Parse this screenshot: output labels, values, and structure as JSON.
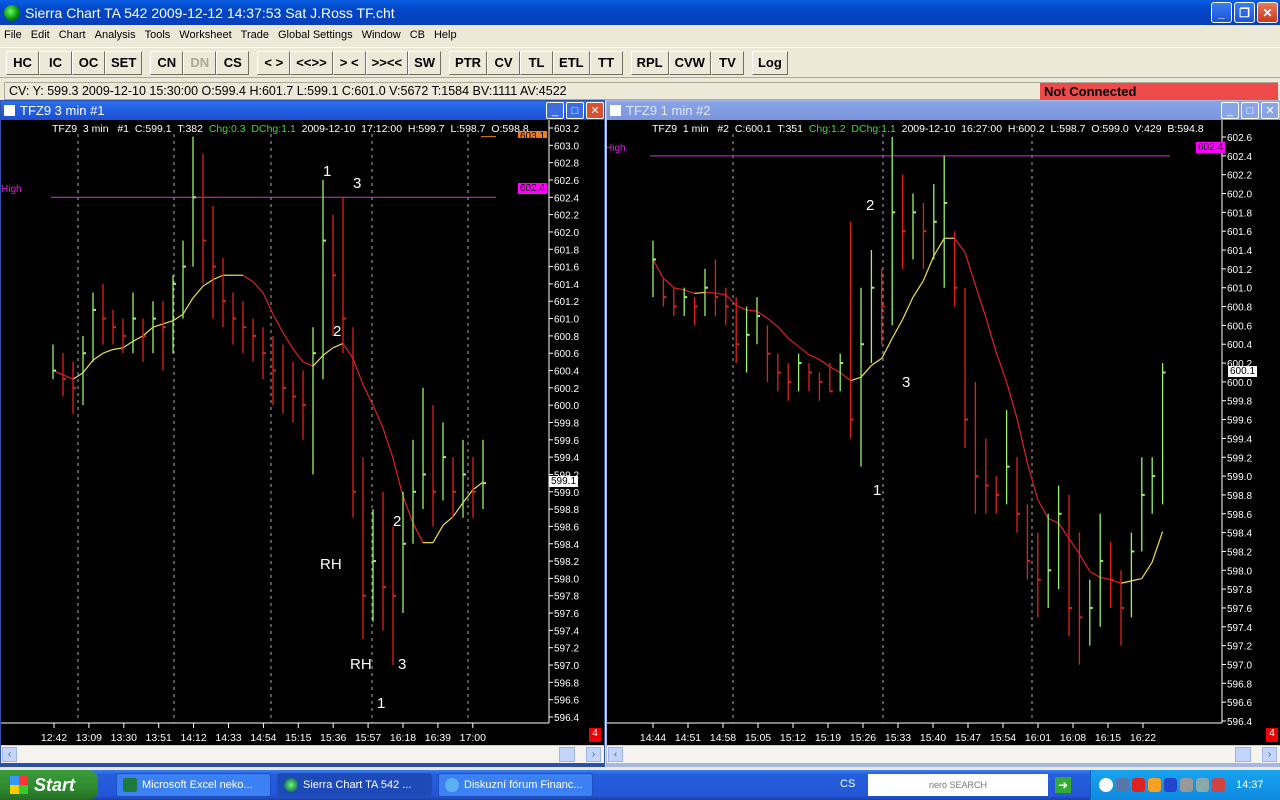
{
  "window": {
    "title": "Sierra Chart TA 542  2009-12-12  14:37:53  Sat   J.Ross TF.cht"
  },
  "menu": [
    "File",
    "Edit",
    "Chart",
    "Analysis",
    "Tools",
    "Worksheet",
    "Trade",
    "Global Settings",
    "Window",
    "CB",
    "Help"
  ],
  "toolbar": [
    "HC",
    "IC",
    "OC",
    "SET",
    "CN",
    "DN",
    "CS",
    "< >",
    "<<>>",
    "> <",
    ">><<",
    "SW",
    "PTR",
    "CV",
    "TL",
    "ETL",
    "TT",
    "RPL",
    "CVW",
    "TV",
    "Log"
  ],
  "status": {
    "cursor_values": "CV: Y: 599.3  2009-12-10  15:30:00  O:599.4  H:601.7  L:599.1  C:601.0  V:5672  T:1584  BV:1111  AV:4522",
    "connection": "Not Connected",
    "connection_color": "#ef4a4a"
  },
  "charts": [
    {
      "title": "TFZ9  3 min   #1",
      "header_a": "TFZ9  3 min   #1  C:599.1  T:382  ",
      "header_chg": "Chg:0.3  DChg:1.1",
      "header_b": "  2009-12-10  17:12:00  H:599.7  L:598.7  O:598.8",
      "high_label": "High",
      "high_tag": "602.4",
      "top_tag": "603.1",
      "last_tag": "599.1",
      "page_num": "4",
      "annotations": [
        "1",
        "3",
        "2",
        "2",
        "RH",
        "RH",
        "3",
        "1"
      ]
    },
    {
      "title": "TFZ9  1 min   #2",
      "header_a": "TFZ9  1 min   #2  C:600.1  T:351  ",
      "header_chg": "Chg:1.2  DChg:1.1",
      "header_b": "  2009-12-10  16:27:00  H:600.2  L:598.7  O:599.0  V:429  B:594.8",
      "high_label": "High",
      "high_tag": "602.4",
      "last_tag": "600.1",
      "page_num": "4",
      "annotations": [
        "2",
        "3",
        "1"
      ]
    }
  ],
  "chart_data": [
    {
      "type": "ohlc",
      "title": "TFZ9 3 min #1",
      "ylim": [
        596.4,
        603.2
      ],
      "high_line": 602.4,
      "top_line": 603.1,
      "up_color": "#9cf06a",
      "down_color": "#e02020",
      "y_ticks": [
        "603.2",
        "603.0",
        "602.8",
        "602.6",
        "602.4",
        "602.2",
        "602.0",
        "601.8",
        "601.6",
        "601.4",
        "601.2",
        "601.0",
        "600.8",
        "600.6",
        "600.4",
        "600.2",
        "600.0",
        "599.8",
        "599.6",
        "599.4",
        "599.2",
        "599.0",
        "598.8",
        "598.6",
        "598.4",
        "598.2",
        "598.0",
        "597.8",
        "597.6",
        "597.4",
        "597.2",
        "597.0",
        "596.8",
        "596.6",
        "596.4"
      ],
      "x_ticks": [
        "12:42",
        "13:09",
        "13:30",
        "13:51",
        "14:12",
        "14:33",
        "14:54",
        "15:15",
        "15:36",
        "15:57",
        "16:18",
        "16:39",
        "17:00"
      ],
      "bars_hlc": [
        [
          600.7,
          600.3,
          600.4
        ],
        [
          600.6,
          600.1,
          600.3
        ],
        [
          600.5,
          599.9,
          600.2
        ],
        [
          600.8,
          600.0,
          600.6
        ],
        [
          601.3,
          600.5,
          601.1
        ],
        [
          601.4,
          600.7,
          601.0
        ],
        [
          601.1,
          600.7,
          600.9
        ],
        [
          601.0,
          600.6,
          600.8
        ],
        [
          601.3,
          600.6,
          601.0
        ],
        [
          601.0,
          600.5,
          600.8
        ],
        [
          601.2,
          600.6,
          601.0
        ],
        [
          601.2,
          600.4,
          600.9
        ],
        [
          601.5,
          600.6,
          601.4
        ],
        [
          601.9,
          601.0,
          601.6
        ],
        [
          603.1,
          601.6,
          602.4
        ],
        [
          602.9,
          601.4,
          601.9
        ],
        [
          602.3,
          601.0,
          601.6
        ],
        [
          601.7,
          600.9,
          601.2
        ],
        [
          601.3,
          600.7,
          601.0
        ],
        [
          601.2,
          600.6,
          600.9
        ],
        [
          601.0,
          600.5,
          600.8
        ],
        [
          600.9,
          600.3,
          600.6
        ],
        [
          600.8,
          600.0,
          600.4
        ],
        [
          600.7,
          599.9,
          600.2
        ],
        [
          600.5,
          599.8,
          600.1
        ],
        [
          600.4,
          599.6,
          600.0
        ],
        [
          600.9,
          599.2,
          600.6
        ],
        [
          602.6,
          600.3,
          601.9
        ],
        [
          602.2,
          600.8,
          601.5
        ],
        [
          602.4,
          600.6,
          601.0
        ],
        [
          600.9,
          598.7,
          599.0
        ],
        [
          599.4,
          597.3,
          597.8
        ],
        [
          598.8,
          597.5,
          598.2
        ],
        [
          599.0,
          597.4,
          597.9
        ],
        [
          598.6,
          597.0,
          597.8
        ],
        [
          599.0,
          597.6,
          598.4
        ],
        [
          599.6,
          598.4,
          599.0
        ],
        [
          600.2,
          598.8,
          599.2
        ],
        [
          600.0,
          598.6,
          599.0
        ],
        [
          599.8,
          598.9,
          599.4
        ],
        [
          599.4,
          598.7,
          599.0
        ],
        [
          599.6,
          598.7,
          599.2
        ],
        [
          599.4,
          598.7,
          599.0
        ],
        [
          599.6,
          598.8,
          599.1
        ]
      ]
    },
    {
      "type": "ohlc",
      "title": "TFZ9 1 min #2",
      "ylim": [
        596.4,
        602.6
      ],
      "high_line": 602.4,
      "up_color": "#9cf06a",
      "down_color": "#e02020",
      "y_ticks": [
        "602.6",
        "602.4",
        "602.2",
        "602.0",
        "601.8",
        "601.6",
        "601.4",
        "601.2",
        "601.0",
        "600.8",
        "600.6",
        "600.4",
        "600.2",
        "600.0",
        "599.8",
        "599.6",
        "599.4",
        "599.2",
        "599.0",
        "598.8",
        "598.6",
        "598.4",
        "598.2",
        "598.0",
        "597.8",
        "597.6",
        "597.4",
        "597.2",
        "597.0",
        "596.8",
        "596.6",
        "596.4"
      ],
      "x_ticks": [
        "14:44",
        "14:51",
        "14:58",
        "15:05",
        "15:12",
        "15:19",
        "15:26",
        "15:33",
        "15:40",
        "15:47",
        "15:54",
        "16:01",
        "16:08",
        "16:15",
        "16:22"
      ],
      "bars_hlc": [
        [
          601.5,
          600.9,
          601.3
        ],
        [
          601.1,
          600.8,
          600.9
        ],
        [
          601.0,
          600.7,
          600.8
        ],
        [
          601.0,
          600.7,
          600.9
        ],
        [
          600.9,
          600.6,
          600.8
        ],
        [
          601.2,
          600.7,
          601.0
        ],
        [
          601.3,
          600.7,
          600.9
        ],
        [
          601.0,
          600.6,
          600.8
        ],
        [
          600.9,
          600.2,
          600.4
        ],
        [
          600.8,
          600.1,
          600.5
        ],
        [
          600.9,
          600.4,
          600.7
        ],
        [
          600.6,
          600.0,
          600.3
        ],
        [
          600.3,
          599.9,
          600.1
        ],
        [
          600.2,
          599.8,
          600.0
        ],
        [
          600.3,
          599.9,
          600.2
        ],
        [
          600.2,
          599.9,
          600.1
        ],
        [
          600.1,
          599.8,
          600.0
        ],
        [
          600.2,
          599.9,
          599.9
        ],
        [
          600.3,
          599.9,
          600.2
        ],
        [
          601.7,
          599.4,
          599.6
        ],
        [
          601.0,
          599.1,
          600.4
        ],
        [
          601.4,
          600.2,
          601.0
        ],
        [
          601.2,
          600.4,
          600.8
        ],
        [
          602.6,
          600.6,
          601.8
        ],
        [
          602.2,
          601.2,
          601.6
        ],
        [
          602.0,
          601.3,
          601.8
        ],
        [
          601.9,
          601.2,
          601.6
        ],
        [
          602.1,
          601.3,
          601.7
        ],
        [
          602.4,
          601.0,
          601.9
        ],
        [
          601.6,
          600.8,
          601.0
        ],
        [
          601.0,
          599.3,
          599.6
        ],
        [
          600.0,
          598.6,
          599.0
        ],
        [
          599.4,
          598.6,
          598.9
        ],
        [
          599.0,
          598.6,
          598.8
        ],
        [
          599.7,
          598.7,
          599.1
        ],
        [
          599.2,
          598.4,
          598.6
        ],
        [
          598.7,
          597.9,
          598.1
        ],
        [
          598.4,
          597.5,
          597.9
        ],
        [
          598.6,
          597.6,
          598.0
        ],
        [
          598.9,
          597.8,
          598.6
        ],
        [
          598.8,
          597.3,
          597.6
        ],
        [
          598.4,
          597.0,
          597.5
        ],
        [
          597.9,
          597.2,
          597.6
        ],
        [
          598.6,
          597.4,
          598.1
        ],
        [
          598.3,
          597.6,
          597.9
        ],
        [
          598.0,
          597.2,
          597.6
        ],
        [
          598.4,
          597.5,
          598.2
        ],
        [
          599.2,
          598.2,
          598.8
        ],
        [
          599.2,
          598.6,
          599.0
        ],
        [
          600.2,
          598.7,
          600.1
        ]
      ]
    }
  ],
  "taskbar": {
    "start": "Start",
    "tasks": [
      "Microsoft Excel neko...",
      "Sierra Chart TA 542 ...",
      "Diskuzní fórum Financ..."
    ],
    "language": "CS",
    "search": "nero SEARCH",
    "clock": "14:37"
  }
}
